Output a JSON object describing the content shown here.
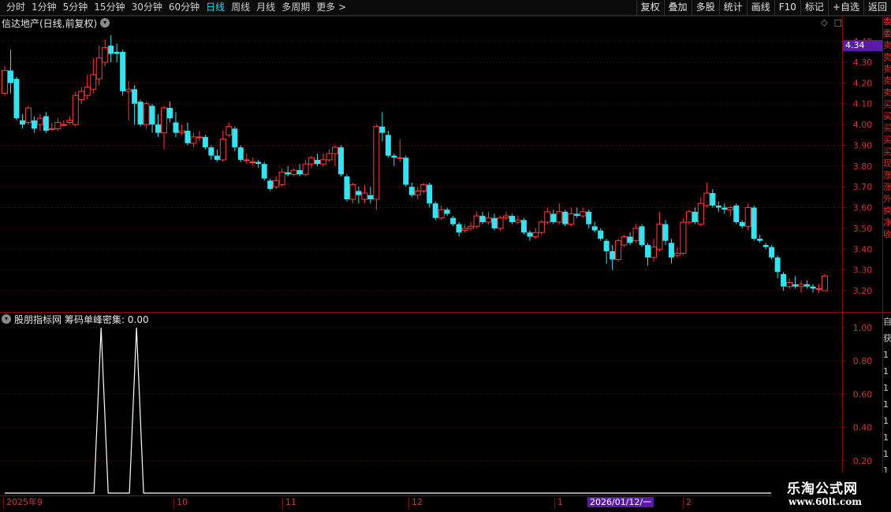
{
  "toolbar": {
    "periods": [
      "分时",
      "1分钟",
      "5分钟",
      "15分钟",
      "30分钟",
      "60分钟",
      "日线",
      "周线",
      "月线",
      "多周期",
      "更多 >"
    ],
    "active_period": "日线",
    "tools": [
      "复权",
      "叠加",
      "多股",
      "统计",
      "画线",
      "F10",
      "标记",
      "+自选",
      "返回"
    ]
  },
  "main_chart": {
    "title": "信达地产(日线,前复权)",
    "current_price_tag": "4.34",
    "price_axis_labels": [
      "4.40",
      "4.30",
      "4.20",
      "4.10",
      "4.00",
      "3.90",
      "3.80",
      "3.70",
      "3.60",
      "3.50",
      "3.40",
      "3.30",
      "3.20"
    ]
  },
  "indicator": {
    "name": "股朋指标网",
    "value_label": "筹码单峰密集: 0.00",
    "axis_labels": [
      "1.00",
      "0.80",
      "0.60",
      "0.40",
      "0.20"
    ]
  },
  "side_strip": [
    "委",
    "委",
    "卖",
    "卖",
    "卖",
    "卖",
    "卖",
    "买",
    "买",
    "买",
    "买",
    "买",
    "现",
    "涨",
    "涨",
    "外",
    "换",
    "净",
    "收"
  ],
  "side_strip2": [
    "自",
    "获",
    "1",
    "1",
    "1",
    "1",
    "1",
    "1",
    "1",
    "1"
  ],
  "date_axis": {
    "labels": [
      "2025年9",
      "10",
      "11",
      "12",
      "1",
      "2"
    ],
    "cursor_date": "2026/01/12/一"
  },
  "watermark": {
    "title": "乐淘公式网",
    "url": "www.60lt.com"
  },
  "colors": {
    "up": "#ff3c3c",
    "down": "#35e3f0",
    "grid": "#7a1010",
    "accent": "#5b1aa8"
  },
  "chart_data": {
    "type": "candlestick",
    "price_range": [
      3.16,
      4.44
    ],
    "candles": [
      [
        4.15,
        4.26,
        4.28,
        4.14
      ],
      [
        4.26,
        4.2,
        4.36,
        4.15
      ],
      [
        4.22,
        4.03,
        4.23,
        4.02
      ],
      [
        4.02,
        4.0,
        4.05,
        3.98
      ],
      [
        4.01,
        4.08,
        4.09,
        4.0
      ],
      [
        4.02,
        3.98,
        4.04,
        3.96
      ],
      [
        4.0,
        4.03,
        4.05,
        3.97
      ],
      [
        4.04,
        3.97,
        4.06,
        3.96
      ],
      [
        3.98,
        3.98,
        4.01,
        3.97
      ],
      [
        3.98,
        4.01,
        4.03,
        3.97
      ],
      [
        4.0,
        4.0,
        4.02,
        3.99
      ],
      [
        4.01,
        4.02,
        4.04,
        4.0
      ],
      [
        4.0,
        4.14,
        4.16,
        3.99
      ],
      [
        4.12,
        4.16,
        4.18,
        4.1
      ],
      [
        4.14,
        4.18,
        4.24,
        4.12
      ],
      [
        4.17,
        4.24,
        4.32,
        4.15
      ],
      [
        4.22,
        4.32,
        4.38,
        4.19
      ],
      [
        4.3,
        4.37,
        4.41,
        4.28
      ],
      [
        4.38,
        4.34,
        4.43,
        4.3
      ],
      [
        4.35,
        4.34,
        4.39,
        4.3
      ],
      [
        4.35,
        4.16,
        4.36,
        4.14
      ],
      [
        4.16,
        4.17,
        4.21,
        4.02
      ],
      [
        4.17,
        4.1,
        4.19,
        4.0
      ],
      [
        4.11,
        4.0,
        4.12,
        3.99
      ],
      [
        4.0,
        4.1,
        4.11,
        3.98
      ],
      [
        4.09,
        4.0,
        4.1,
        3.96
      ],
      [
        4.0,
        3.96,
        4.05,
        3.94
      ],
      [
        3.96,
        4.08,
        4.09,
        3.88
      ],
      [
        4.08,
        4.03,
        4.11,
        4.01
      ],
      [
        4.01,
        3.96,
        4.06,
        3.94
      ],
      [
        3.96,
        3.97,
        4.0,
        3.95
      ],
      [
        3.97,
        3.91,
        4.01,
        3.9
      ],
      [
        3.91,
        3.94,
        3.96,
        3.89
      ],
      [
        3.94,
        3.94,
        3.97,
        3.92
      ],
      [
        3.94,
        3.89,
        3.95,
        3.88
      ],
      [
        3.89,
        3.85,
        3.9,
        3.83
      ],
      [
        3.85,
        3.83,
        3.88,
        3.82
      ],
      [
        3.83,
        3.93,
        3.97,
        3.82
      ],
      [
        3.95,
        3.99,
        4.01,
        3.94
      ],
      [
        3.98,
        3.89,
        3.99,
        3.87
      ],
      [
        3.89,
        3.83,
        3.9,
        3.82
      ],
      [
        3.83,
        3.83,
        3.86,
        3.81
      ],
      [
        3.82,
        3.82,
        3.84,
        3.8
      ],
      [
        3.82,
        3.81,
        3.83,
        3.79
      ],
      [
        3.81,
        3.74,
        3.82,
        3.73
      ],
      [
        3.73,
        3.69,
        3.74,
        3.68
      ],
      [
        3.7,
        3.73,
        3.75,
        3.69
      ],
      [
        3.71,
        3.77,
        3.79,
        3.7
      ],
      [
        3.77,
        3.76,
        3.8,
        3.75
      ],
      [
        3.76,
        3.78,
        3.79,
        3.75
      ],
      [
        3.78,
        3.76,
        3.81,
        3.75
      ],
      [
        3.76,
        3.81,
        3.83,
        3.75
      ],
      [
        3.81,
        3.84,
        3.85,
        3.79
      ],
      [
        3.83,
        3.81,
        3.86,
        3.8
      ],
      [
        3.81,
        3.83,
        3.86,
        3.8
      ],
      [
        3.83,
        3.86,
        3.88,
        3.82
      ],
      [
        3.86,
        3.89,
        3.9,
        3.8
      ],
      [
        3.89,
        3.76,
        3.9,
        3.75
      ],
      [
        3.75,
        3.64,
        3.76,
        3.63
      ],
      [
        3.64,
        3.71,
        3.72,
        3.62
      ],
      [
        3.68,
        3.66,
        3.7,
        3.62
      ],
      [
        3.64,
        3.67,
        3.71,
        3.62
      ],
      [
        3.66,
        3.64,
        3.7,
        3.62
      ],
      [
        3.64,
        3.99,
        4.0,
        3.59
      ],
      [
        3.99,
        3.96,
        4.06,
        3.92
      ],
      [
        3.95,
        3.85,
        3.97,
        3.84
      ],
      [
        3.85,
        3.84,
        3.86,
        3.8
      ],
      [
        3.84,
        3.84,
        3.93,
        3.82
      ],
      [
        3.84,
        3.71,
        3.85,
        3.7
      ],
      [
        3.7,
        3.66,
        3.72,
        3.65
      ],
      [
        3.66,
        3.68,
        3.7,
        3.64
      ],
      [
        3.68,
        3.71,
        3.72,
        3.67
      ],
      [
        3.71,
        3.62,
        3.72,
        3.6
      ],
      [
        3.62,
        3.55,
        3.63,
        3.54
      ],
      [
        3.55,
        3.59,
        3.61,
        3.54
      ],
      [
        3.59,
        3.57,
        3.6,
        3.56
      ],
      [
        3.55,
        3.52,
        3.56,
        3.51
      ],
      [
        3.52,
        3.48,
        3.53,
        3.46
      ],
      [
        3.49,
        3.5,
        3.52,
        3.48
      ],
      [
        3.5,
        3.51,
        3.53,
        3.49
      ],
      [
        3.51,
        3.56,
        3.58,
        3.5
      ],
      [
        3.56,
        3.53,
        3.58,
        3.52
      ],
      [
        3.53,
        3.55,
        3.58,
        3.52
      ],
      [
        3.55,
        3.5,
        3.57,
        3.49
      ],
      [
        3.5,
        3.55,
        3.56,
        3.49
      ],
      [
        3.55,
        3.56,
        3.58,
        3.54
      ],
      [
        3.56,
        3.53,
        3.57,
        3.52
      ],
      [
        3.53,
        3.54,
        3.56,
        3.52
      ],
      [
        3.54,
        3.48,
        3.55,
        3.47
      ],
      [
        3.48,
        3.46,
        3.49,
        3.44
      ],
      [
        3.46,
        3.48,
        3.5,
        3.45
      ],
      [
        3.48,
        3.53,
        3.54,
        3.47
      ],
      [
        3.53,
        3.58,
        3.6,
        3.52
      ],
      [
        3.57,
        3.53,
        3.59,
        3.52
      ],
      [
        3.53,
        3.58,
        3.62,
        3.52
      ],
      [
        3.58,
        3.52,
        3.59,
        3.51
      ],
      [
        3.52,
        3.57,
        3.6,
        3.51
      ],
      [
        3.57,
        3.56,
        3.6,
        3.55
      ],
      [
        3.56,
        3.58,
        3.6,
        3.55
      ],
      [
        3.58,
        3.52,
        3.59,
        3.5
      ],
      [
        3.51,
        3.49,
        3.53,
        3.48
      ],
      [
        3.49,
        3.45,
        3.5,
        3.44
      ],
      [
        3.44,
        3.39,
        3.45,
        3.33
      ],
      [
        3.39,
        3.35,
        3.42,
        3.3
      ],
      [
        3.35,
        3.44,
        3.45,
        3.34
      ],
      [
        3.42,
        3.46,
        3.47,
        3.41
      ],
      [
        3.46,
        3.43,
        3.48,
        3.42
      ],
      [
        3.44,
        3.5,
        3.52,
        3.43
      ],
      [
        3.51,
        3.42,
        3.52,
        3.41
      ],
      [
        3.42,
        3.36,
        3.43,
        3.32
      ],
      [
        3.36,
        3.41,
        3.45,
        3.34
      ],
      [
        3.4,
        3.52,
        3.58,
        3.39
      ],
      [
        3.52,
        3.44,
        3.54,
        3.42
      ],
      [
        3.43,
        3.36,
        3.45,
        3.33
      ],
      [
        3.37,
        3.38,
        3.41,
        3.36
      ],
      [
        3.38,
        3.53,
        3.55,
        3.37
      ],
      [
        3.53,
        3.58,
        3.59,
        3.52
      ],
      [
        3.58,
        3.53,
        3.6,
        3.52
      ],
      [
        3.52,
        3.62,
        3.65,
        3.51
      ],
      [
        3.61,
        3.67,
        3.72,
        3.6
      ],
      [
        3.67,
        3.61,
        3.69,
        3.6
      ],
      [
        3.61,
        3.6,
        3.63,
        3.58
      ],
      [
        3.6,
        3.59,
        3.62,
        3.57
      ],
      [
        3.59,
        3.6,
        3.61,
        3.56
      ],
      [
        3.61,
        3.53,
        3.62,
        3.52
      ],
      [
        3.53,
        3.51,
        3.54,
        3.5
      ],
      [
        3.51,
        3.6,
        3.62,
        3.49
      ],
      [
        3.6,
        3.45,
        3.61,
        3.44
      ],
      [
        3.45,
        3.44,
        3.47,
        3.43
      ],
      [
        3.42,
        3.41,
        3.43,
        3.4
      ],
      [
        3.41,
        3.36,
        3.42,
        3.35
      ],
      [
        3.36,
        3.29,
        3.37,
        3.26
      ],
      [
        3.28,
        3.22,
        3.29,
        3.2
      ],
      [
        3.22,
        3.24,
        3.26,
        3.21
      ],
      [
        3.23,
        3.22,
        3.27,
        3.21
      ],
      [
        3.22,
        3.23,
        3.25,
        3.19
      ],
      [
        3.23,
        3.22,
        3.25,
        3.21
      ],
      [
        3.22,
        3.21,
        3.23,
        3.19
      ],
      [
        3.21,
        3.21,
        3.23,
        3.19
      ],
      [
        3.2,
        3.27,
        3.28,
        3.2
      ]
    ],
    "indicator_series": {
      "name": "筹码单峰密集",
      "spikes_at_index": [
        15,
        21
      ],
      "spike_value": 1.0,
      "y_range": [
        0,
        1.05
      ]
    }
  }
}
